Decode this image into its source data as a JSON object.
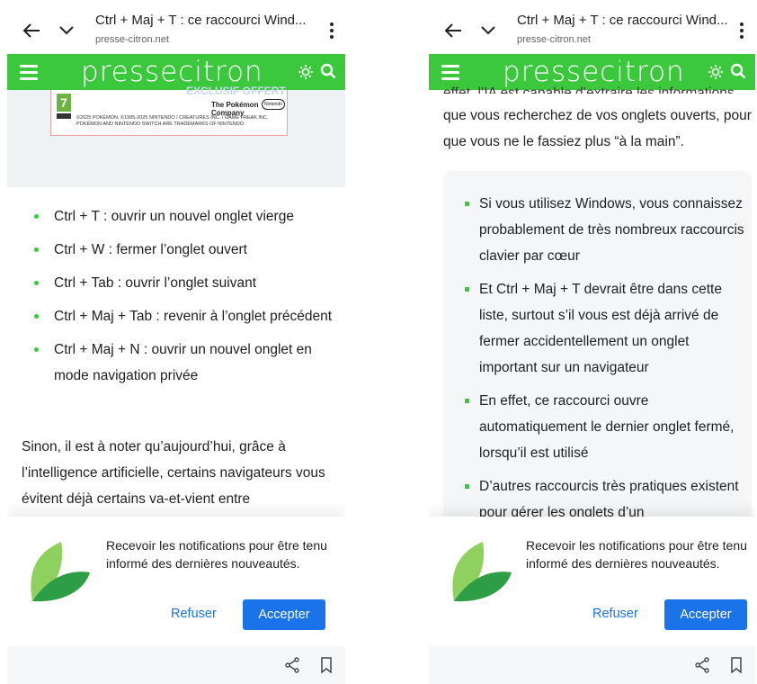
{
  "left": {
    "chrome": {
      "title": "Ctrl + Maj + T : ce raccourci Wind...",
      "url": "presse-citron.net"
    },
    "header": {
      "logo": "pressecitron"
    },
    "promo": {
      "badge": "7",
      "exclusive": "EXCLUSIF OFFERT",
      "company": "The Pokémon Company",
      "nintendo": "Nintendo",
      "legal": "©2025 Pokémon. ©1995-2025 Nintendo / Creatures Inc. / GAME FREAK inc. Pokémon and Nintendo Switch are trademarks of Nintendo."
    },
    "bullets": [
      {
        "key": "Ctrl + T",
        "text": " : ouvrir un nouvel onglet vierge"
      },
      {
        "key": "Ctrl + W",
        "text": " : fermer l’onglet ouvert"
      },
      {
        "key": "Ctrl + Tab",
        "text": " : ouvrir l’onglet suivant"
      },
      {
        "key": "Ctrl + Maj + Tab",
        "text": " : revenir à l’onglet précédent"
      },
      {
        "key": "Ctrl + Maj + N",
        "text": " : ouvrir un nouvel onglet en mode navigation privée"
      }
    ],
    "paragraph": "Sinon, il est à noter qu’aujourd’hui, grâce à l’intelligence artificielle, certains navigateurs vous évitent déjà certains va-et-vient entre",
    "notification": {
      "text": "Recevoir les notifications pour être tenu informé des dernières nouveautés.",
      "refuse": "Refuser",
      "accept": "Accepter"
    }
  },
  "right": {
    "chrome": {
      "title": "Ctrl + Maj + T : ce raccourci Wind...",
      "url": "presse-citron.net"
    },
    "header": {
      "logo": "pressecitron"
    },
    "clipped": "effet, l’IA est capable d’extraire les informations",
    "paragraph": "que vous recherchez de vos onglets ouverts, pour que vous ne le fassiez plus “à la main”.",
    "bullets": [
      "Si vous utilisez Windows, vous connaissez probablement de très nombreux raccourcis clavier par cœur",
      "Et Ctrl + Maj + T devrait être dans cette liste, surtout s’il vous est déjà arrivé de fermer accidentellement un onglet important sur un navigateur",
      "En effet, ce raccourci ouvre automatiquement le dernier onglet fermé, lorsqu’il est utilisé",
      "D’autres raccourcis très pratiques existent pour gérer les onglets d’un"
    ],
    "notification": {
      "text": "Recevoir les notifications pour être tenu informé des dernières nouveautés.",
      "refuse": "Refuser",
      "accept": "Accepter"
    }
  },
  "colors": {
    "brand_green": "#3cc83c",
    "accept_blue": "#1a73e8",
    "leaf_light": "#8fd15f",
    "leaf_dark": "#2e9e46"
  },
  "icons": [
    "back-arrow-icon",
    "chevron-down-icon",
    "kebab-menu-icon",
    "hamburger-menu-icon",
    "brightness-icon",
    "search-icon",
    "leaf-logo-icon",
    "share-icon",
    "bookmark-icon"
  ]
}
